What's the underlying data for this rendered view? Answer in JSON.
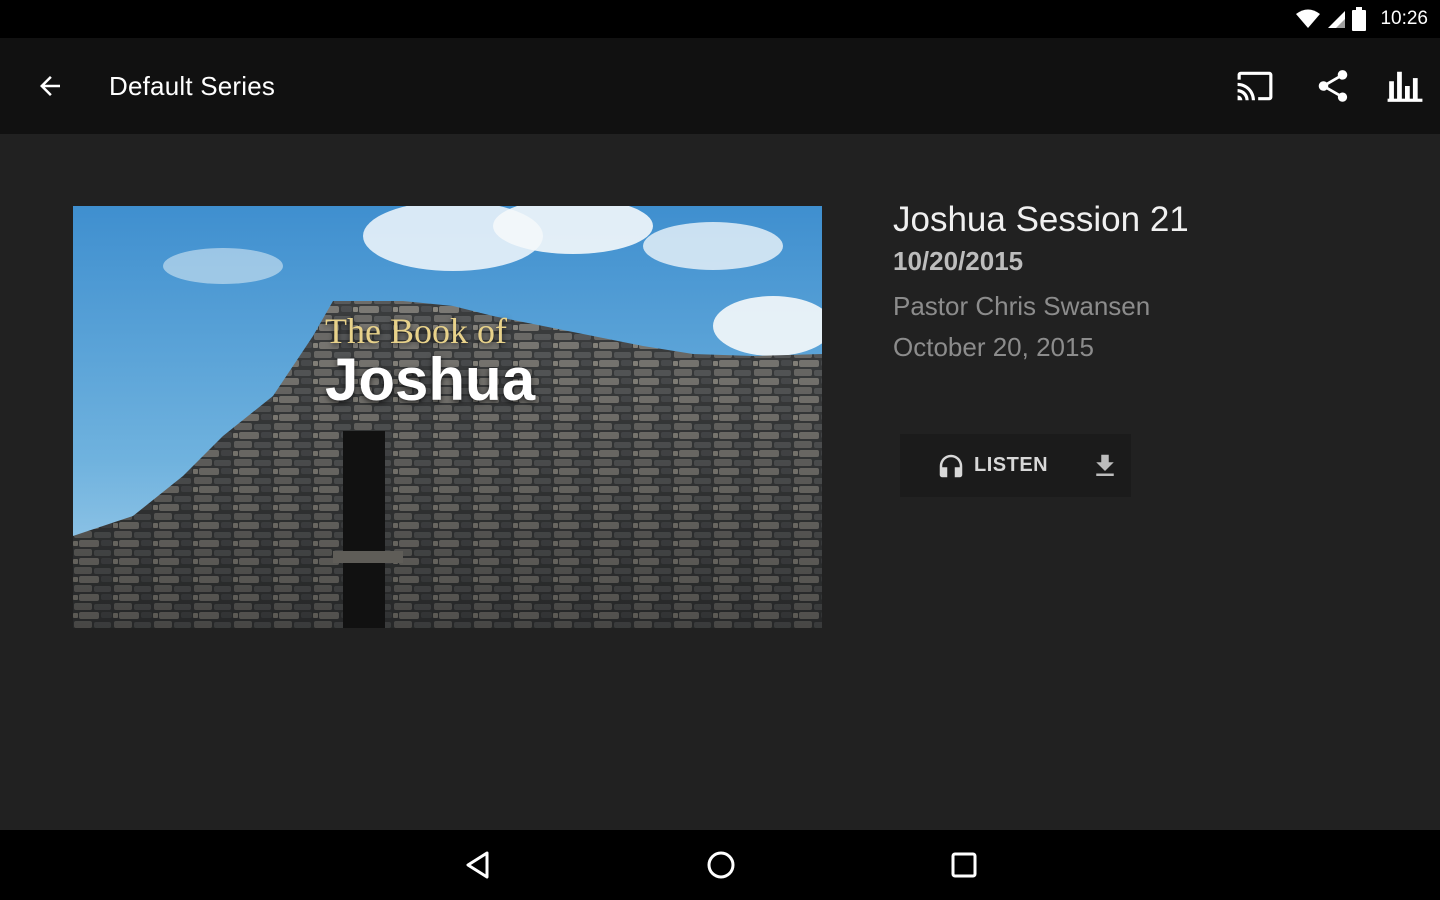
{
  "status_bar": {
    "time": "10:26",
    "icons": [
      "wifi-icon",
      "cell-signal-icon",
      "battery-icon"
    ]
  },
  "app_bar": {
    "title": "Default Series",
    "nav_icon": "arrow-back-icon",
    "actions": [
      "cast-icon",
      "share-icon",
      "bar-chart-icon"
    ]
  },
  "sermon": {
    "artwork": {
      "line1": "The Book of",
      "line2": "Joshua"
    },
    "title": "Joshua Session 21",
    "date": "10/20/2015",
    "speaker": "Pastor  Chris Swansen",
    "long_date": "October 20, 2015"
  },
  "actions": {
    "listen_label": "LISTEN",
    "listen_icon": "headphones-icon",
    "download_icon": "download-icon"
  },
  "nav_bar": {
    "icons": [
      "nav-back-icon",
      "nav-home-icon",
      "nav-recents-icon"
    ]
  },
  "colors": {
    "background": "#212121",
    "app_bar": "#111111",
    "system_bars": "#000000",
    "artwork_title_accent": "#e8d28a"
  }
}
